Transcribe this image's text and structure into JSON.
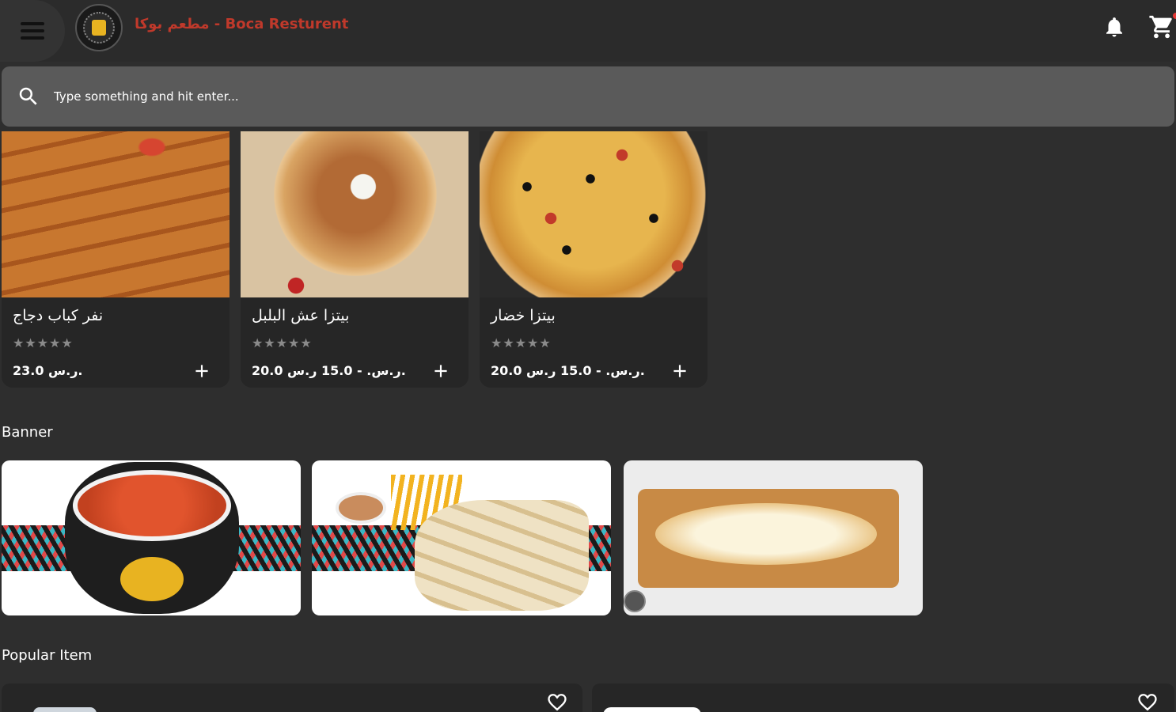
{
  "header": {
    "title": "مطعم بوكا - Boca Resturent",
    "menu_icon": "hamburger-menu-icon",
    "notification_icon": "bell-icon",
    "cart_icon": "cart-icon"
  },
  "search": {
    "placeholder": "Type something and hit enter...",
    "value": ""
  },
  "products": [
    {
      "name": "نفر كباب دجاج",
      "price": "23.0 ر.س.",
      "rating_stars": "★★★★★",
      "rating": 0
    },
    {
      "name": "بيتزا عش البلبل",
      "price": "20.0 ر.س. - 15.0 ر.س.",
      "rating_stars": "★★★★★",
      "rating": 0
    },
    {
      "name": "بيتزا خضار",
      "price": "20.0 ر.س. - 15.0 ر.س.",
      "rating_stars": "★★★★★",
      "rating": 0
    }
  ],
  "sections": {
    "banner_title": "Banner",
    "popular_title": "Popular Item"
  },
  "colors": {
    "background": "#2e2e2e",
    "title_accent": "#c0392b",
    "search_bar": "#5a5a5a"
  }
}
